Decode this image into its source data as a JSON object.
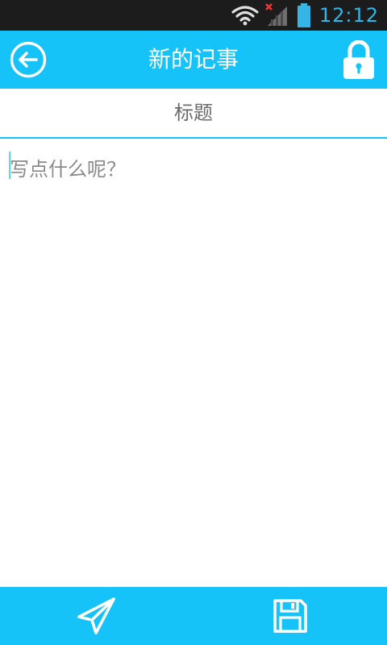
{
  "status_bar": {
    "time": "12:12",
    "icons": [
      "wifi-icon",
      "signal-no-service-icon",
      "battery-icon"
    ],
    "time_color": "#33b5e5"
  },
  "header": {
    "title": "新的记事",
    "back_icon": "back-arrow-circle-icon",
    "lock_icon": "lock-icon",
    "background_color": "#15c3f8"
  },
  "editor": {
    "title_placeholder": "标题",
    "title_value": "",
    "content_placeholder": "写点什么呢？",
    "content_value": ""
  },
  "bottom_bar": {
    "send_icon": "send-paper-plane-icon",
    "save_icon": "save-floppy-icon",
    "background_color": "#15c3f8"
  }
}
